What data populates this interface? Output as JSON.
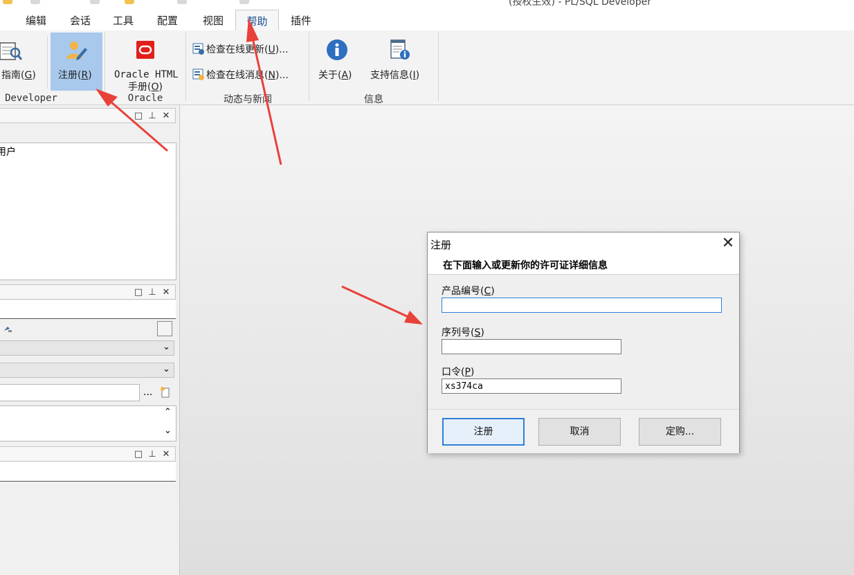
{
  "window": {
    "title": "(授权生效) - PL/SQL Developer"
  },
  "menu": {
    "tabs": [
      {
        "label": "编辑"
      },
      {
        "label": "会话"
      },
      {
        "label": "工具"
      },
      {
        "label": "配置"
      },
      {
        "label": "视图"
      },
      {
        "label": "帮助",
        "active": true
      },
      {
        "label": "插件"
      }
    ]
  },
  "ribbon": {
    "developer": {
      "group_label": "Developer",
      "guide": {
        "text": "指南(",
        "key": "G",
        "close": ")"
      },
      "register": {
        "text": "注册(",
        "key": "R",
        "close": ")"
      }
    },
    "oracle": {
      "group_label": "Oracle",
      "html_manual_line1": "Oracle HTML",
      "html_manual_line2": {
        "text": "手册(",
        "key": "O",
        "close": ")"
      }
    },
    "news": {
      "group_label": "动态与新闻",
      "check_updates": {
        "text": "检查在线更新(",
        "key": "U",
        "close": ")..."
      },
      "check_news": {
        "text": "检查在线消息(",
        "key": "N",
        "close": ")..."
      }
    },
    "info": {
      "group_label": "信息",
      "about": {
        "text": "关于(",
        "key": "A",
        "close": ")"
      },
      "support": {
        "text": "支持信息(",
        "key": "I",
        "close": ")"
      }
    }
  },
  "left_panel": {
    "tree_item": "用户",
    "ellipsis": "..."
  },
  "dialog": {
    "title": "注册",
    "subtitle": "在下面输入或更新你的许可证详细信息",
    "product_label": {
      "text": "产品编号(",
      "key": "C",
      "close": ")"
    },
    "product_value": "",
    "serial_label": {
      "text": "序列号(",
      "key": "S",
      "close": ")"
    },
    "serial_value": "",
    "password_label": {
      "text": "口令(",
      "key": "P",
      "close": ")"
    },
    "password_value": "xs374ca",
    "buttons": {
      "register": "注册",
      "cancel": "取消",
      "order": "定购..."
    }
  },
  "colors": {
    "accent": "#2f7ed8",
    "annotation_arrow": "#e8413a",
    "register_highlight": "#a8c8ec"
  }
}
